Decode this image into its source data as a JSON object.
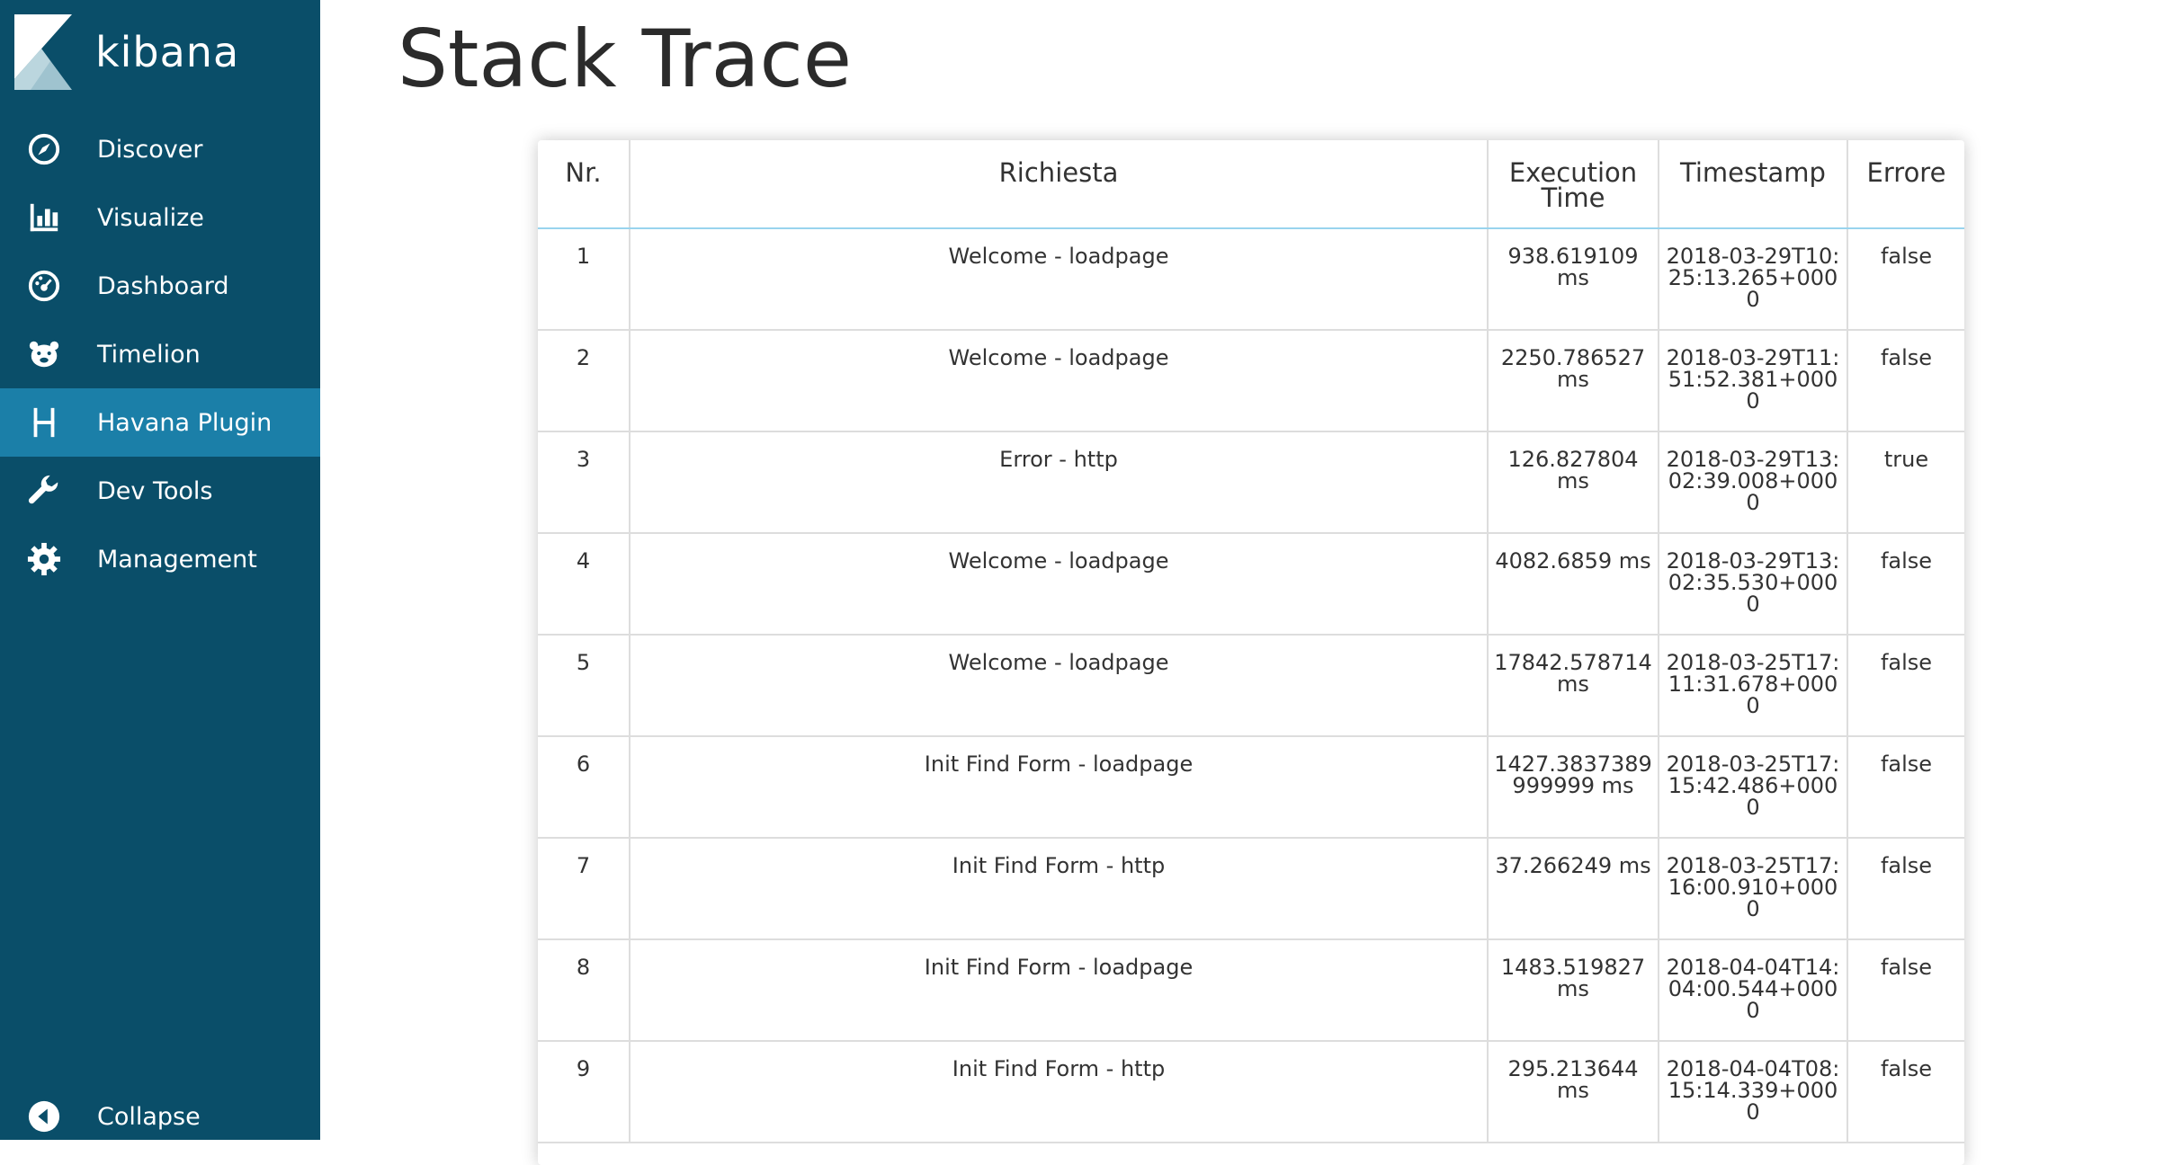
{
  "app": {
    "brand_name": "kibana"
  },
  "sidebar": {
    "items": [
      {
        "label": "Discover",
        "icon": "compass-icon"
      },
      {
        "label": "Visualize",
        "icon": "bar-chart-icon"
      },
      {
        "label": "Dashboard",
        "icon": "dashboard-gauge-icon"
      },
      {
        "label": "Timelion",
        "icon": "timelion-bear-icon"
      },
      {
        "label": "Havana Plugin",
        "icon": "letter-h-icon",
        "active": true
      },
      {
        "label": "Dev Tools",
        "icon": "wrench-icon"
      },
      {
        "label": "Management",
        "icon": "gear-icon"
      }
    ],
    "collapse_label": "Collapse"
  },
  "page": {
    "title": "Stack Trace"
  },
  "table": {
    "columns": [
      "Nr.",
      "Richiesta",
      "Execution Time",
      "Timestamp",
      "Errore"
    ],
    "rows": [
      {
        "nr": "1",
        "richiesta": "Welcome - loadpage",
        "execution_time": "938.619109 ms",
        "timestamp": "2018-03-29T10:25:13.265+0000",
        "errore": "false"
      },
      {
        "nr": "2",
        "richiesta": "Welcome - loadpage",
        "execution_time": "2250.786527 ms",
        "timestamp": "2018-03-29T11:51:52.381+0000",
        "errore": "false"
      },
      {
        "nr": "3",
        "richiesta": "Error - http",
        "execution_time": "126.827804 ms",
        "timestamp": "2018-03-29T13:02:39.008+0000",
        "errore": "true"
      },
      {
        "nr": "4",
        "richiesta": "Welcome - loadpage",
        "execution_time": "4082.6859 ms",
        "timestamp": "2018-03-29T13:02:35.530+0000",
        "errore": "false"
      },
      {
        "nr": "5",
        "richiesta": "Welcome - loadpage",
        "execution_time": "17842.578714 ms",
        "timestamp": "2018-03-25T17:11:31.678+0000",
        "errore": "false"
      },
      {
        "nr": "6",
        "richiesta": "Init Find Form - loadpage",
        "execution_time": "1427.3837389999999 ms",
        "timestamp": "2018-03-25T17:15:42.486+0000",
        "errore": "false"
      },
      {
        "nr": "7",
        "richiesta": "Init Find Form - http",
        "execution_time": "37.266249 ms",
        "timestamp": "2018-03-25T17:16:00.910+0000",
        "errore": "false"
      },
      {
        "nr": "8",
        "richiesta": "Init Find Form - loadpage",
        "execution_time": "1483.519827 ms",
        "timestamp": "2018-04-04T14:04:00.544+0000",
        "errore": "false"
      },
      {
        "nr": "9",
        "richiesta": "Init Find Form - http",
        "execution_time": "295.213644 ms",
        "timestamp": "2018-04-04T08:15:14.339+0000",
        "errore": "false"
      }
    ]
  },
  "colors": {
    "sidebar_bg": "#0a4e69",
    "sidebar_active_bg": "#1b7fa8",
    "header_border": "#99d4ee"
  }
}
